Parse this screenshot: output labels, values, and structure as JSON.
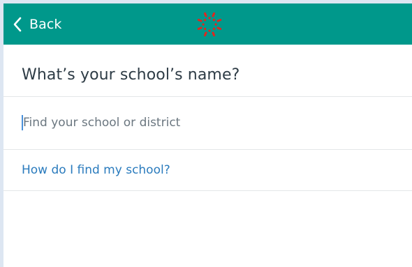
{
  "header": {
    "back_label": "Back",
    "logo_icon": "canvas-logo-icon",
    "brand_color": "#00988b",
    "logo_color": "#e0261f"
  },
  "main": {
    "heading": "What’s your school’s name?",
    "search": {
      "placeholder": "Find your school or district",
      "value": ""
    },
    "help_link": "How do I find my school?"
  }
}
